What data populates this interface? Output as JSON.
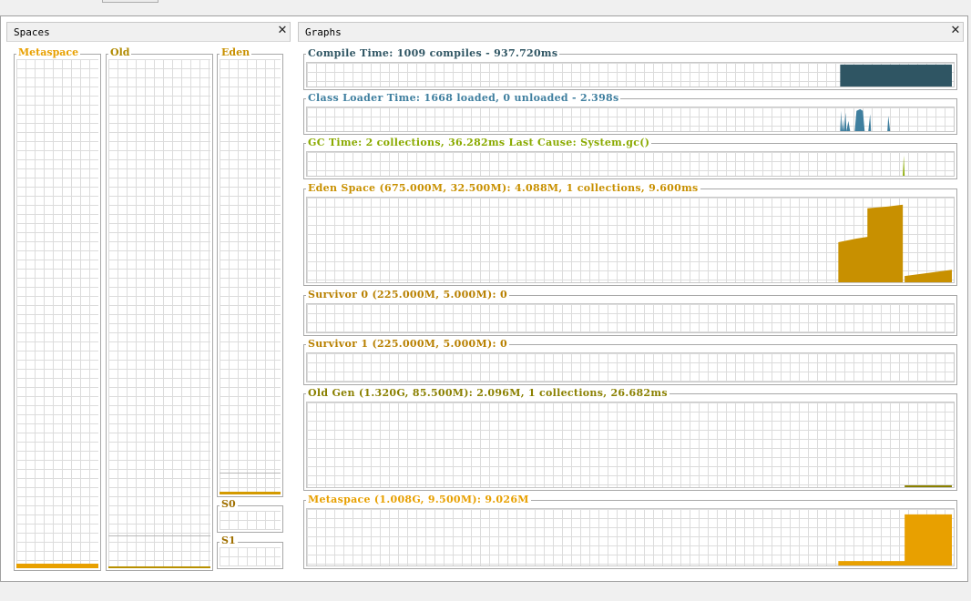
{
  "spaces_panel": {
    "title": "Spaces",
    "items": [
      {
        "label": "Metaspace",
        "color": "#e8a000",
        "used_fraction": 0.01
      },
      {
        "label": "Old",
        "color": "#b89000",
        "used_fraction": 0.005
      },
      {
        "label": "Eden",
        "color": "#d49a00",
        "used_fraction": 0.12
      },
      {
        "label": "S0",
        "color": "#b88000",
        "used_fraction": 0
      },
      {
        "label": "S1",
        "color": "#b88000",
        "used_fraction": 0
      }
    ]
  },
  "graphs_panel": {
    "title": "Graphs",
    "graphs": [
      {
        "label": "Compile Time: 1009 compiles - 937.720ms",
        "color": "#2f5563"
      },
      {
        "label": "Class Loader Time: 1668 loaded, 0 unloaded - 2.398s",
        "color": "#3f7f9f"
      },
      {
        "label": "GC Time: 2 collections, 36.282ms Last Cause: System.gc()",
        "color": "#8aaa00"
      },
      {
        "label": "Eden Space (675.000M, 32.500M): 4.088M, 1 collections, 9.600ms",
        "color": "#c89000"
      },
      {
        "label": "Survivor 0 (225.000M, 5.000M): 0",
        "color": "#b88000"
      },
      {
        "label": "Survivor 1 (225.000M, 5.000M): 0",
        "color": "#b88000"
      },
      {
        "label": "Old Gen (1.320G, 85.500M): 2.096M, 1 collections, 26.682ms",
        "color": "#8a8000"
      },
      {
        "label": "Metaspace (1.008G, 9.500M): 9.026M",
        "color": "#e8a000"
      }
    ]
  }
}
